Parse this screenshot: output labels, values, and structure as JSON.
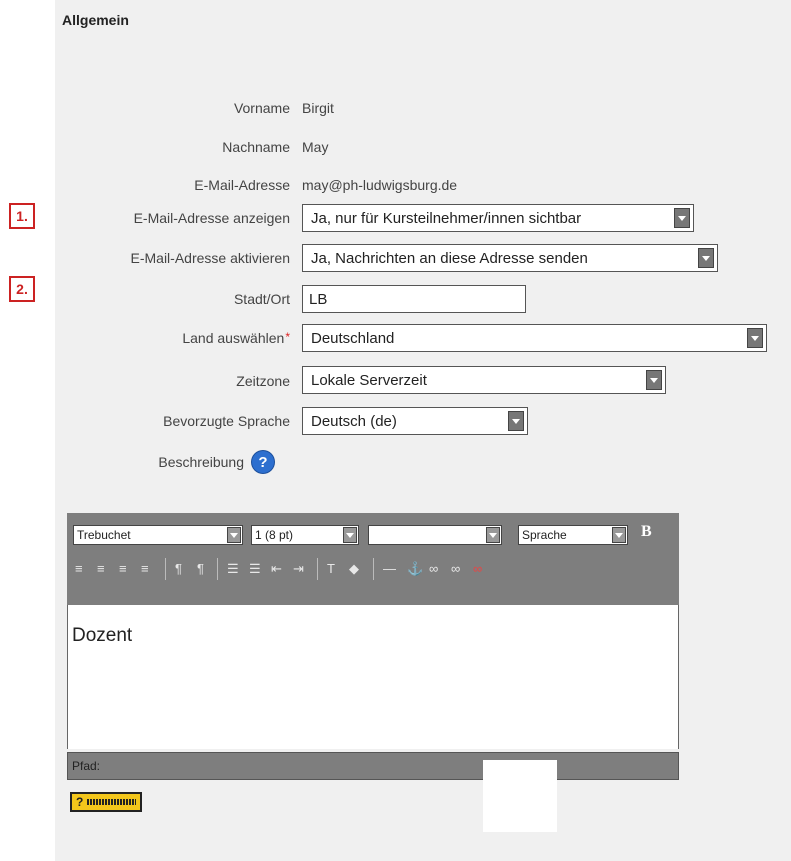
{
  "section": {
    "title": "Allgemein"
  },
  "markers": [
    "1.",
    "2."
  ],
  "fields": {
    "firstname": {
      "label": "Vorname",
      "value": "Birgit"
    },
    "lastname": {
      "label": "Nachname",
      "value": "May"
    },
    "email": {
      "label": "E-Mail-Adresse",
      "value": "may@ph-ludwigsburg.de"
    },
    "email_display": {
      "label": "E-Mail-Adresse anzeigen",
      "value": "Ja, nur für Kursteilnehmer/innen sichtbar"
    },
    "email_enable": {
      "label": "E-Mail-Adresse aktivieren",
      "value": "Ja, Nachrichten an diese Adresse senden"
    },
    "city": {
      "label": "Stadt/Ort",
      "value": "LB"
    },
    "country": {
      "label": "Land auswählen",
      "required_mark": "*",
      "value": "Deutschland"
    },
    "timezone": {
      "label": "Zeitzone",
      "value": "Lokale Serverzeit"
    },
    "language": {
      "label": "Bevorzugte Sprache",
      "value": "Deutsch (de)"
    },
    "description": {
      "label": "Beschreibung",
      "help_icon": "question-circle-icon"
    }
  },
  "editor": {
    "font_family": "Trebuchet",
    "font_size": "1 (8 pt)",
    "format": "",
    "language": "Sprache",
    "bold_label": "B",
    "content": "Dozent",
    "path_label": "Pfad:",
    "toolbar_icons": [
      "align-left-icon",
      "align-center-icon",
      "align-right-icon",
      "align-justify-icon",
      "ltr-icon",
      "rtl-icon",
      "ordered-list-icon",
      "unordered-list-icon",
      "outdent-icon",
      "indent-icon",
      "text-color-icon",
      "background-color-icon",
      "horizontal-rule-icon",
      "anchor-icon",
      "link-icon",
      "unlink-icon",
      "no-link-icon"
    ]
  },
  "help_badge": {
    "label": "?"
  }
}
